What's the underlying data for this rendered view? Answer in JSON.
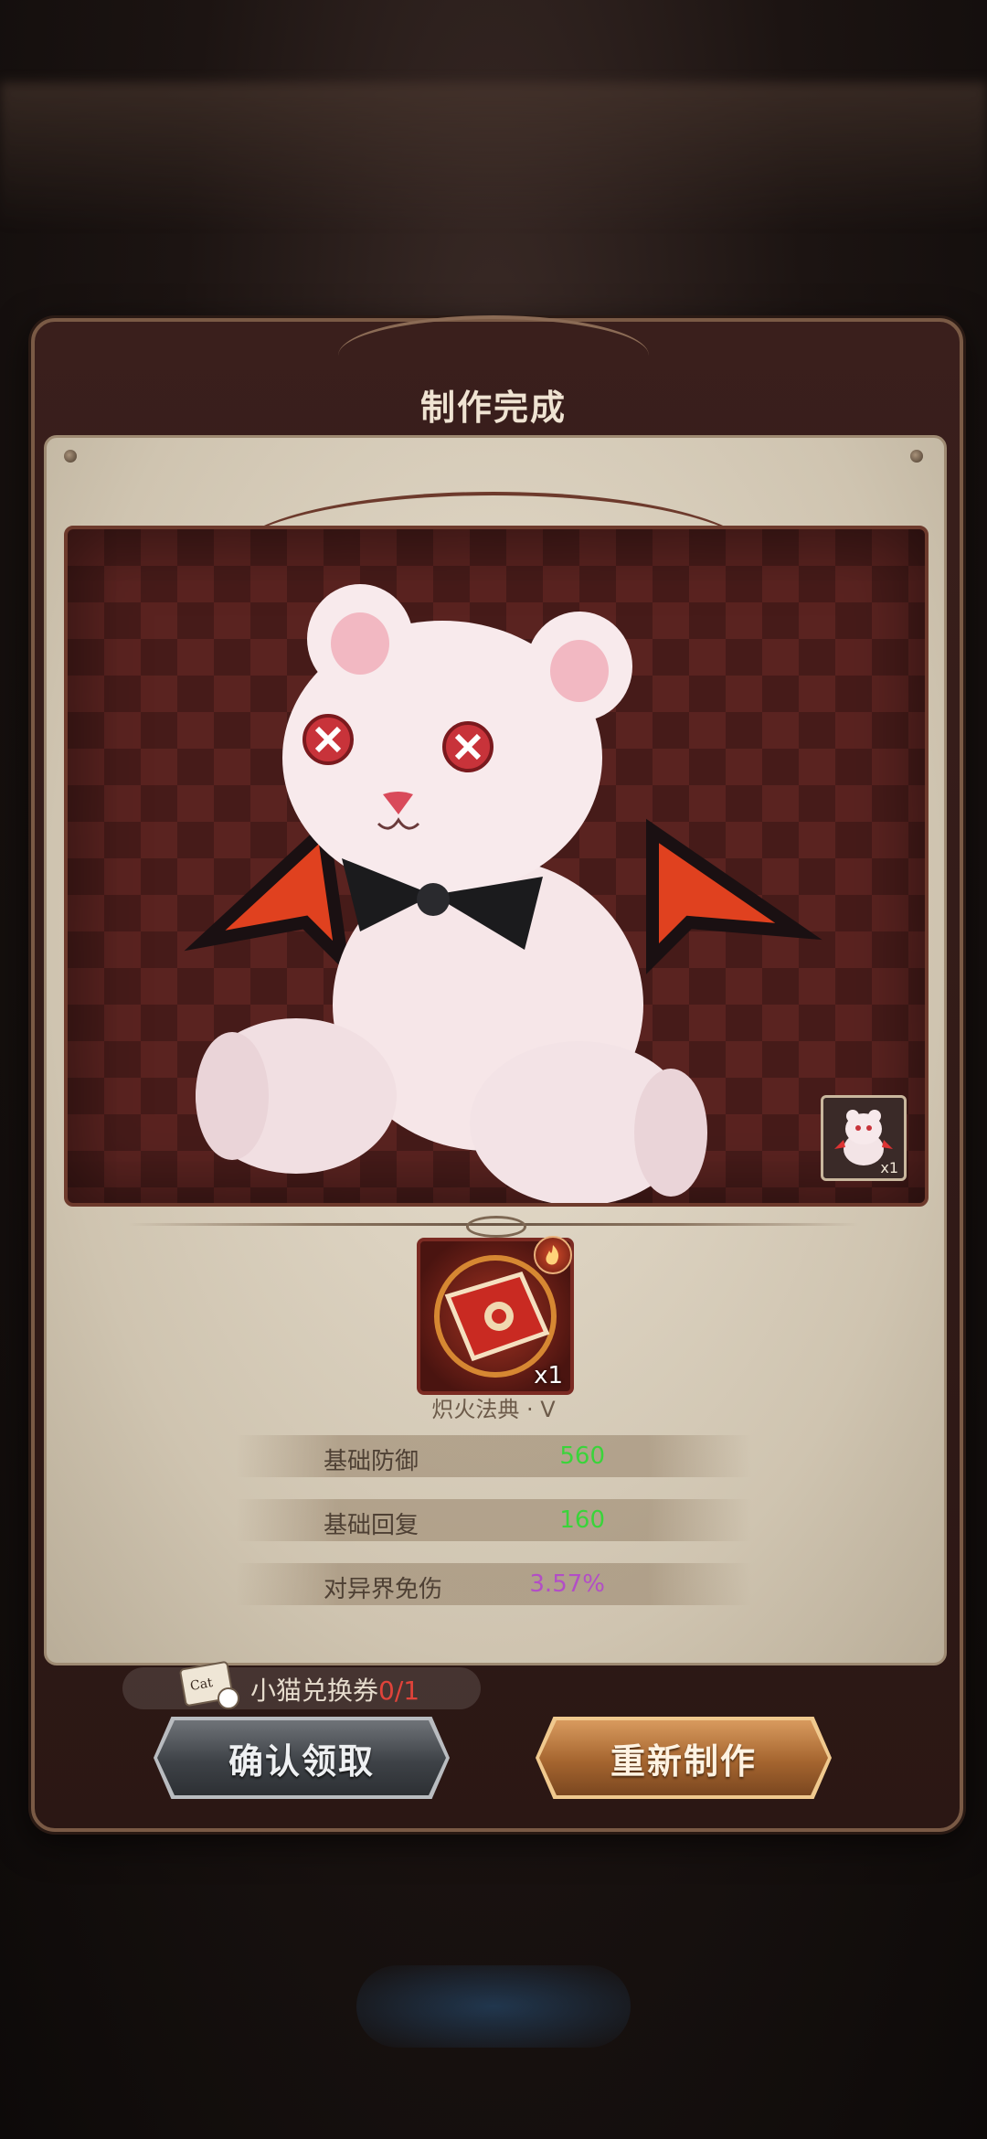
{
  "dialog": {
    "title": "制作完成"
  },
  "preview": {
    "thumbnail_qty": "x1"
  },
  "item": {
    "quantity": "x1",
    "name": "炽火法典 · V"
  },
  "stats": [
    {
      "label": "基础防御",
      "value": "560",
      "color": "#3ad43a"
    },
    {
      "label": "基础回复",
      "value": "160",
      "color": "#3ad43a"
    },
    {
      "label": "对异界免伤",
      "value": "3.57%",
      "color": "#b24ec6"
    }
  ],
  "voucher": {
    "label": "小猫兑换券",
    "count": "0/1",
    "icon_text": "Cat"
  },
  "buttons": {
    "confirm": "确认领取",
    "remake": "重新制作"
  }
}
